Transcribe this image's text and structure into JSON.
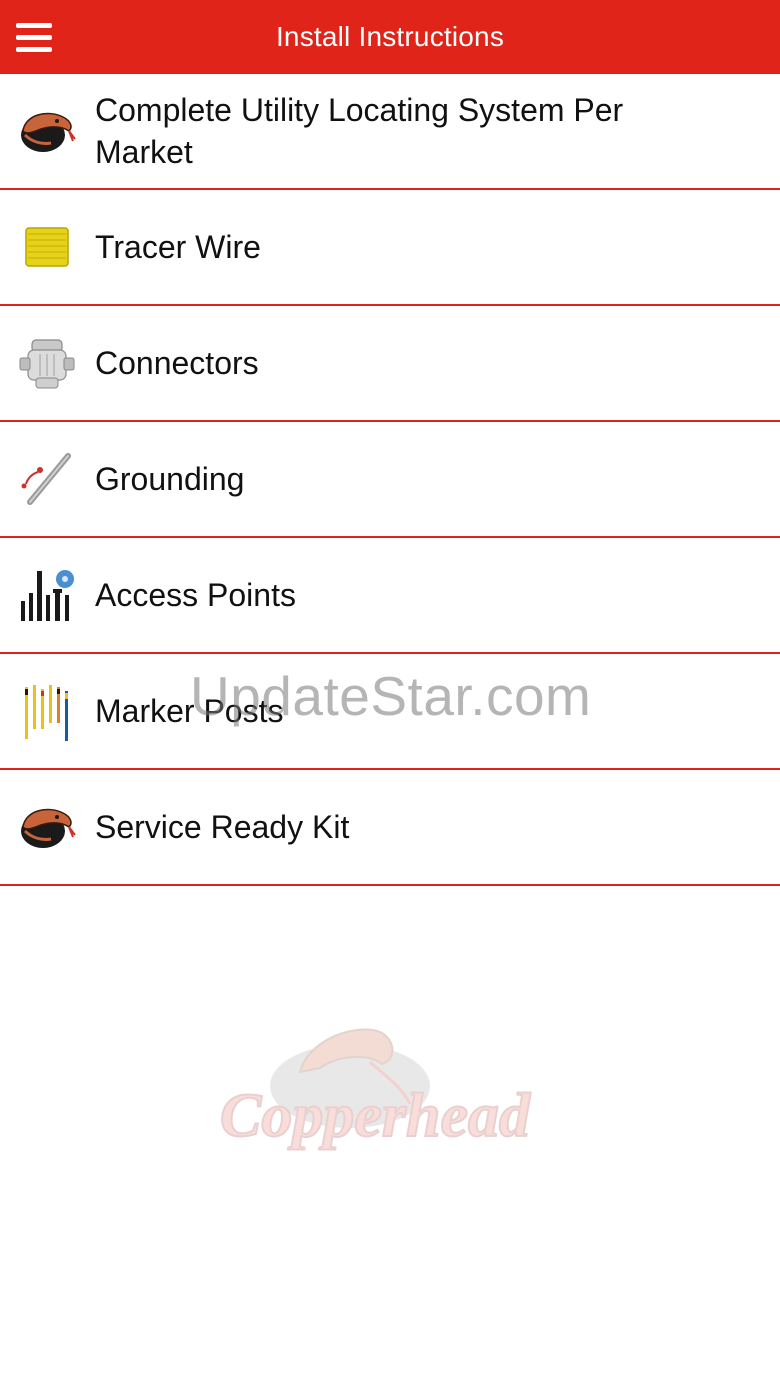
{
  "header": {
    "title": "Install Instructions",
    "menu_icon": "hamburger-menu-icon",
    "background": "#e0241a"
  },
  "list": {
    "items": [
      {
        "label": "Complete Utility Locating System Per Market",
        "icon": "copperhead-snake-icon"
      },
      {
        "label": "Tracer Wire",
        "icon": "wire-spool-icon"
      },
      {
        "label": "Connectors",
        "icon": "connector-icon"
      },
      {
        "label": "Grounding",
        "icon": "grounding-rod-icon"
      },
      {
        "label": "Access Points",
        "icon": "access-points-icon"
      },
      {
        "label": "Marker Posts",
        "icon": "marker-posts-icon"
      },
      {
        "label": "Service Ready Kit",
        "icon": "copperhead-snake-icon"
      }
    ],
    "divider_color": "#e0241a"
  },
  "watermark": {
    "text": "UpdateStar.com"
  },
  "logo": {
    "text": "Copperhead",
    "icon": "copperhead-logo-icon"
  }
}
